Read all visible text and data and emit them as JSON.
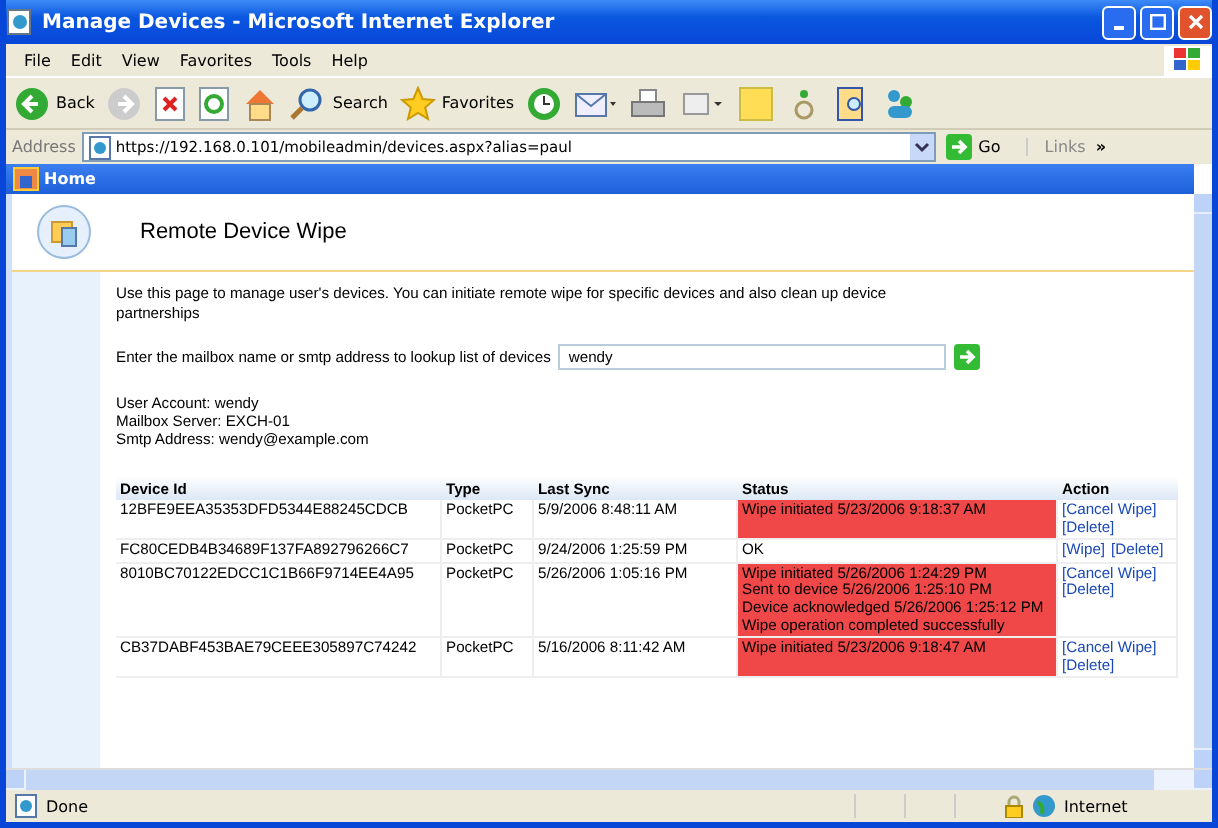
{
  "window": {
    "title": "Manage Devices - Microsoft Internet Explorer"
  },
  "menu": [
    "File",
    "Edit",
    "View",
    "Favorites",
    "Tools",
    "Help"
  ],
  "toolbar": {
    "back": "Back",
    "search": "Search",
    "favorites": "Favorites"
  },
  "address": {
    "label": "Address",
    "url": "https://192.168.0.101/mobileadmin/devices.aspx?alias=paul",
    "go": "Go",
    "links": "Links",
    "more": "»"
  },
  "tab": {
    "title": "Home"
  },
  "page": {
    "heading": "Remote Device Wipe",
    "intro": "Use this page to manage user's devices. You can initiate remote wipe for specific devices and also clean up device partnerships",
    "lookup": {
      "label": "Enter the mailbox name or smtp address to lookup list of devices",
      "value": "wendy"
    },
    "account": [
      "User Account: wendy",
      "Mailbox Server: EXCH-01",
      "Smtp Address: wendy@example.com"
    ]
  },
  "table": {
    "columns": [
      "Device Id",
      "Type",
      "Last Sync",
      "Status",
      "Action"
    ],
    "rows": [
      {
        "device_id": "12BFE9EEA35353DFD5344E88245CDCB",
        "type": "PocketPC",
        "last_sync": "5/9/2006 8:48:11 AM",
        "wipe": true,
        "status": [
          "Wipe initiated 5/23/2006 9:18:37 AM"
        ],
        "actions": [
          "[Cancel Wipe]",
          "[Delete]"
        ]
      },
      {
        "device_id": "FC80CEDB4B34689F137FA892796266C7",
        "type": "PocketPC",
        "last_sync": "9/24/2006 1:25:59 PM",
        "wipe": false,
        "status": [
          "OK"
        ],
        "actions": [
          "[Wipe]",
          "[Delete]"
        ]
      },
      {
        "device_id": "8010BC70122EDCC1C1B66F9714EE4A95",
        "type": "PocketPC",
        "last_sync": "5/26/2006 1:05:16 PM",
        "wipe": true,
        "status": [
          "Wipe initiated 5/26/2006 1:24:29 PM",
          "Sent to device 5/26/2006 1:25:10 PM",
          "Device acknowledged 5/26/2006 1:25:12 PM",
          "Wipe operation completed successfully"
        ],
        "actions": [
          "[Cancel Wipe]",
          "[Delete]"
        ]
      },
      {
        "device_id": "CB37DABF453BAE79CEEE305897C74242",
        "type": "PocketPC",
        "last_sync": "5/16/2006 8:11:42 AM",
        "wipe": true,
        "status": [
          "Wipe initiated 5/23/2006 9:18:47 AM"
        ],
        "actions": [
          "[Cancel Wipe]",
          "[Delete]"
        ]
      }
    ]
  },
  "status_bar": {
    "text": "Done",
    "zone": "Internet"
  }
}
